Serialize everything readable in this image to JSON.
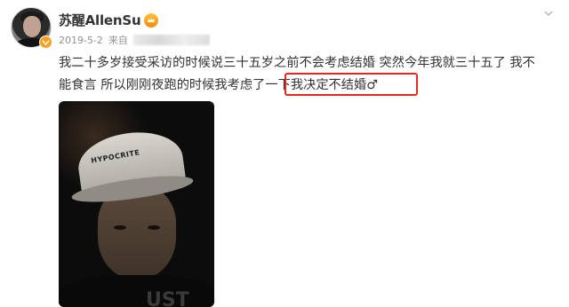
{
  "post": {
    "username": "苏醒AllenSu",
    "date": "2019-5-2",
    "source_prefix": "来自",
    "text_line_1": "我二十多岁接受采访的时候说三十五岁之前不会考虑结婚 突然今年我就三十五了 我不",
    "text_line_2_pre": "能食言 所以刚刚夜跑的时候我考虑了一下",
    "text_line_2_highlight": " 我决定不结婚",
    "text_line_2_tail": "♂",
    "photo_cap_text": "HYPOCRITE",
    "photo_shirt_text": "UST"
  },
  "icons": {
    "avatar": "user-avatar",
    "vip_badge": "vip-badge-icon",
    "member": "member-crown-icon",
    "chevron": "chevron-down-icon"
  },
  "colors": {
    "highlight_border": "#e8281e",
    "meta_gray": "#939393",
    "text": "#333333",
    "member_orange": "#f7a11b"
  }
}
